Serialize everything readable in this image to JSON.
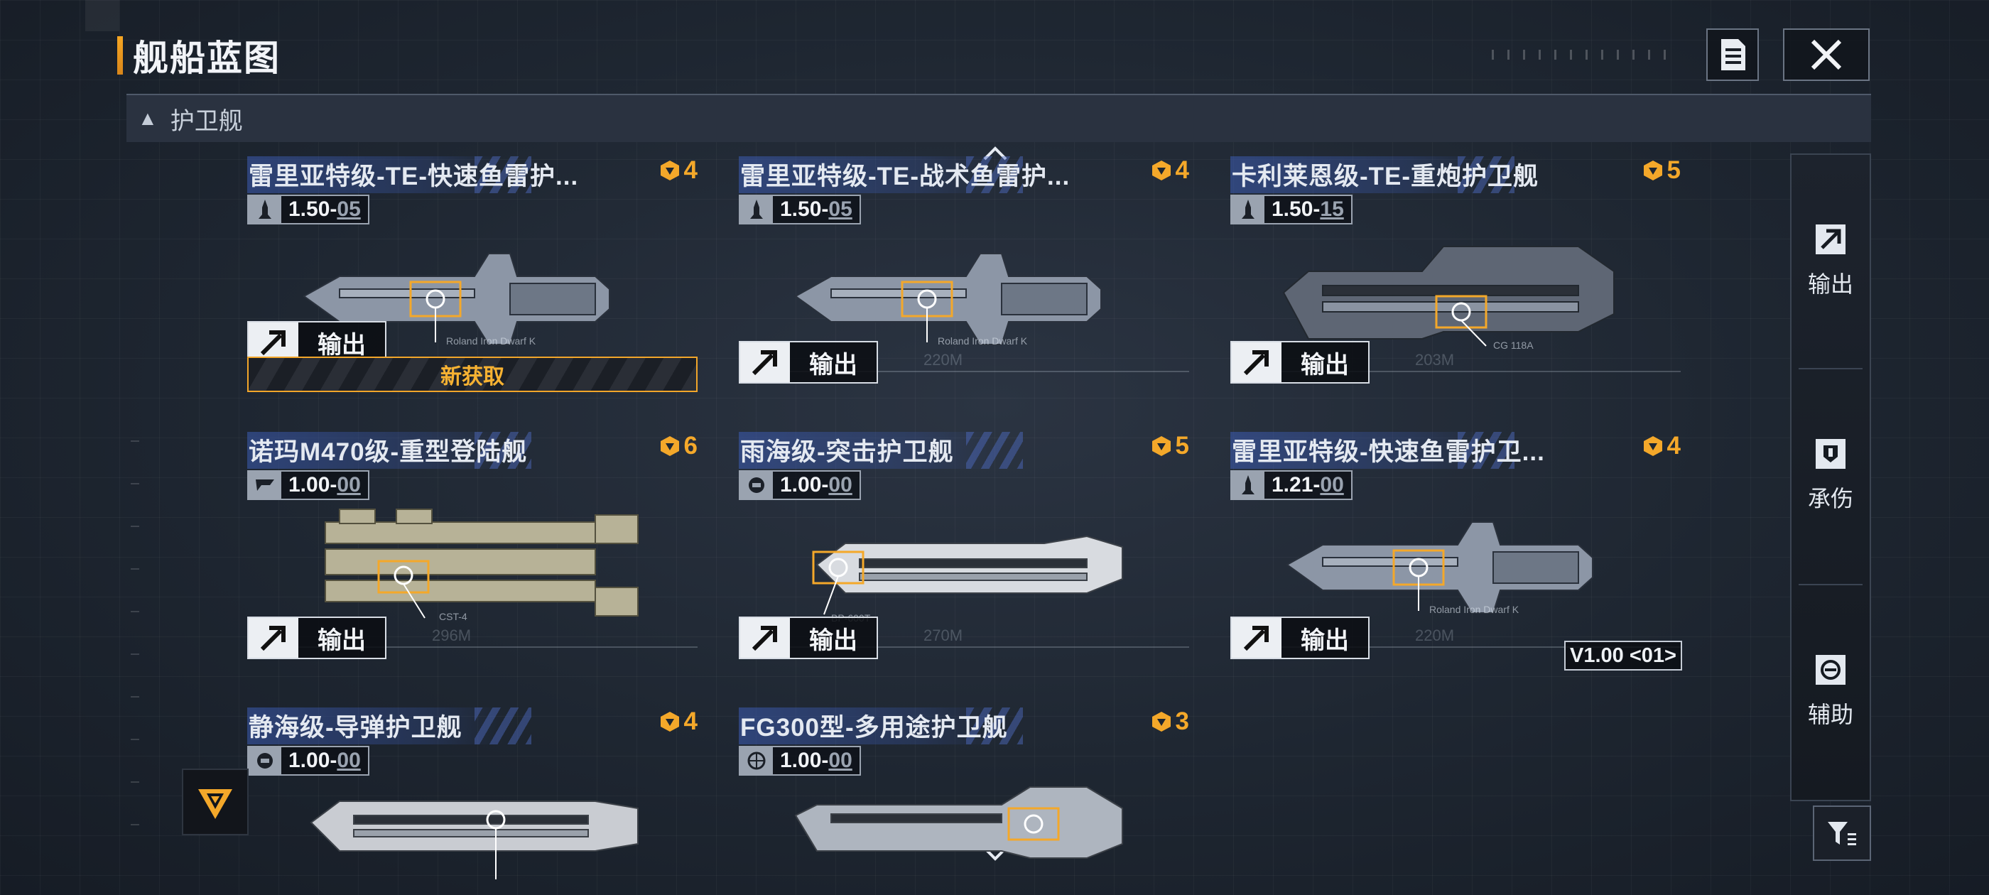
{
  "header": {
    "title": "舰船蓝图"
  },
  "category": {
    "label": "护卫舰"
  },
  "export_label": "输出",
  "cards": [
    {
      "name": "雷里亚特级-TE-快速鱼雷护...",
      "tier": "4",
      "ver_major": "1.50",
      "ver_minor": "05",
      "ver_icon": "rocket-icon",
      "ship_tag": "Roland Iron Dwarf K",
      "length": "",
      "new_label": "新获取",
      "is_new": true
    },
    {
      "name": "雷里亚特级-TE-战术鱼雷护...",
      "tier": "4",
      "ver_major": "1.50",
      "ver_minor": "05",
      "ver_icon": "rocket-icon",
      "ship_tag": "Roland Iron Dwarf K",
      "length": "220M"
    },
    {
      "name": "卡利莱恩级-TE-重炮护卫舰",
      "tier": "5",
      "ver_major": "1.50",
      "ver_minor": "15",
      "ver_icon": "rocket-icon",
      "ship_tag": "CG 118A",
      "length": "203M"
    },
    {
      "name": "诺玛M470级-重型登陆舰",
      "tier": "6",
      "ver_major": "1.00",
      "ver_minor": "00",
      "ver_icon": "flag-icon",
      "ship_tag": "CST-4",
      "length": "296M"
    },
    {
      "name": "雨海级-突击护卫舰",
      "tier": "5",
      "ver_major": "1.00",
      "ver_minor": "00",
      "ver_icon": "shield-badge-icon",
      "ship_tag": "BP-600T",
      "length": "270M"
    },
    {
      "name": "雷里亚特级-快速鱼雷护卫...",
      "tier": "4",
      "ver_major": "1.21",
      "ver_minor": "00",
      "ver_icon": "rocket-icon",
      "ship_tag": "Roland Iron Dwarf K",
      "length": "220M"
    },
    {
      "name": "静海级-导弹护卫舰",
      "tier": "4",
      "ver_major": "1.00",
      "ver_minor": "00",
      "ver_icon": "shield-badge-icon"
    },
    {
      "name": "FG300型-多用途护卫舰",
      "tier": "3",
      "ver_major": "1.00",
      "ver_minor": "00",
      "ver_icon": "globe-icon"
    }
  ],
  "version_badge": "V1.00 <01>",
  "side_panel": [
    {
      "label": "输出",
      "icon": "arrow-export-icon"
    },
    {
      "label": "承伤",
      "icon": "shield-icon"
    },
    {
      "label": "辅助",
      "icon": "support-icon"
    }
  ],
  "colors": {
    "accent": "#f4a82a",
    "panel": "#2a3240",
    "highlight": "#3c5cb4"
  }
}
